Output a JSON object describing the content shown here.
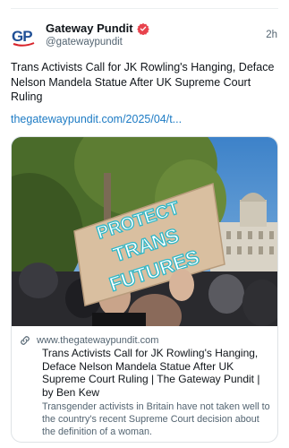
{
  "post": {
    "author_name": "Gateway Pundit",
    "author_handle": "@gatewaypundit",
    "timestamp": "2h",
    "avatar_text": "GP",
    "verified_icon": "verified-badge-icon",
    "text": "Trans Activists Call for JK Rowling's Hanging, Deface Nelson Mandela Statue After UK Supreme Court Ruling",
    "link_text": "thegatewaypundit.com/2025/04/t..."
  },
  "card": {
    "domain_icon": "link-icon",
    "domain": "www.thegatewaypundit.com",
    "title": "Trans Activists Call for JK Rowling's Hanging, Deface Nelson Mandela Statue After UK Supreme Court Ruling | The Gateway Pundit | by Ben Kew",
    "description": "Transgender activists in Britain have not taken well to the country's recent Supreme Court decision about the definition of a woman.",
    "sign_lines": [
      "PROTECT",
      "TRANS",
      "FUTURES"
    ]
  },
  "colors": {
    "link": "#1d7bc4",
    "muted": "#536471",
    "verified": "#e8434d",
    "avatar_blue": "#1f4f96",
    "avatar_red": "#d8232a"
  }
}
